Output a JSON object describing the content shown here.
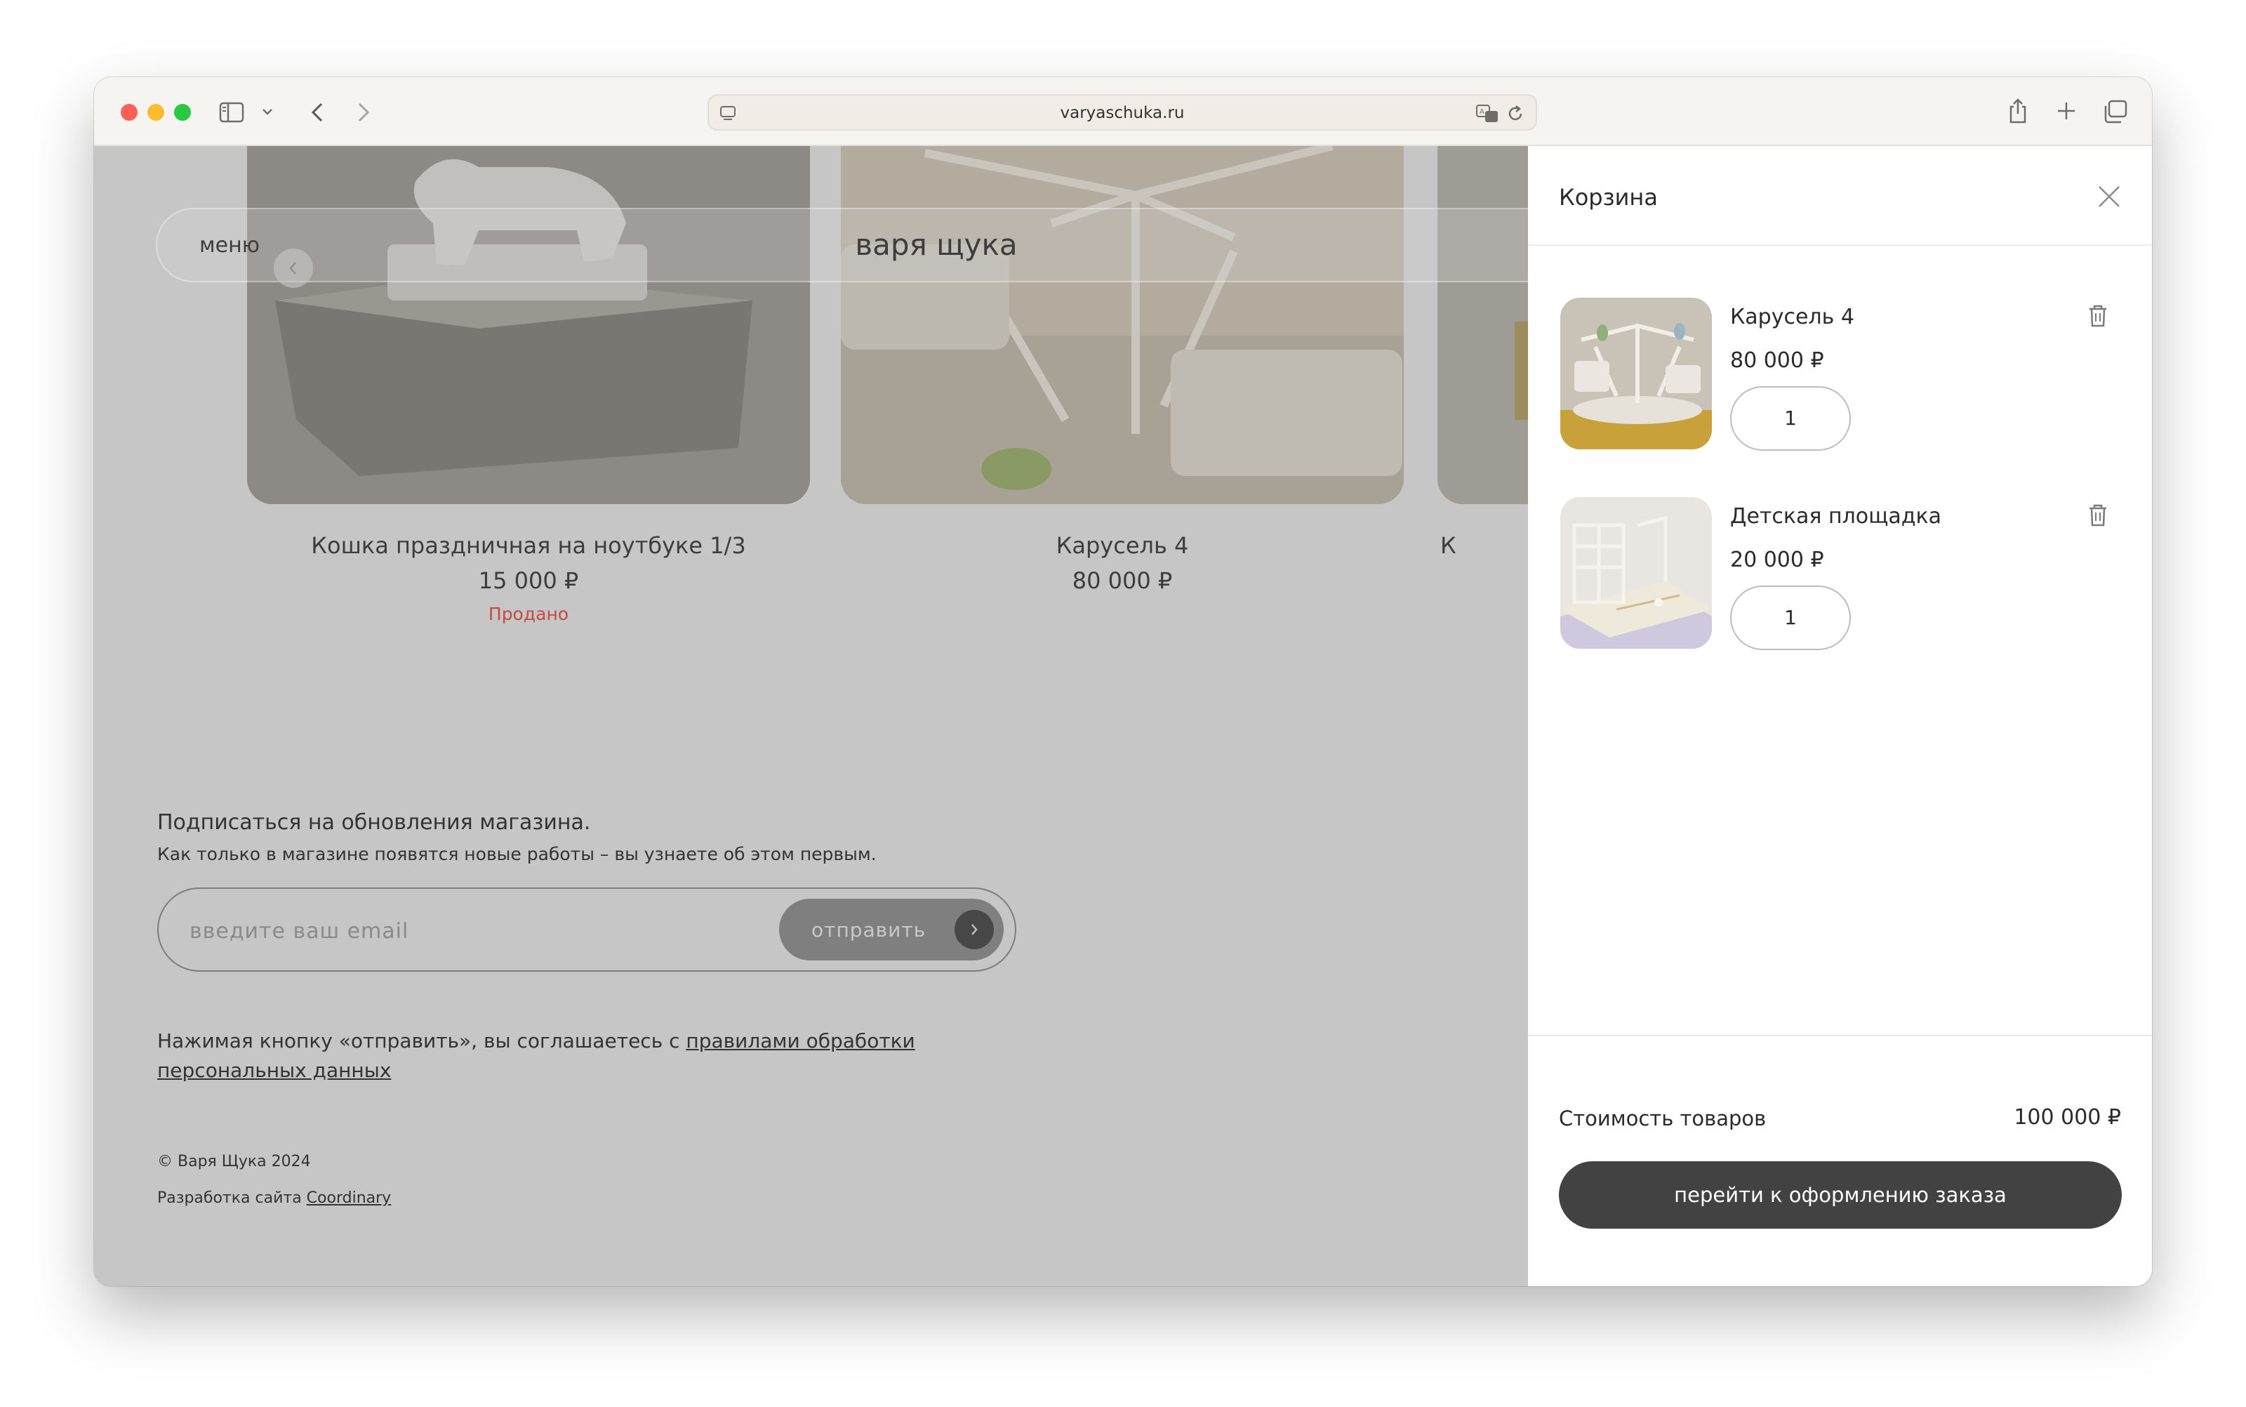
{
  "browser": {
    "url": "varyaschuka.ru",
    "icons": [
      "sidebar-icon",
      "chevron-down-icon",
      "back-icon",
      "forward-icon",
      "translate-icon",
      "reload-icon",
      "share-icon",
      "new-tab-icon",
      "tabs-overview-icon"
    ]
  },
  "header": {
    "menu_label": "меню",
    "brand": "варя щука"
  },
  "products": [
    {
      "title": "Кошка праздничная на ноутбуке 1/3",
      "price": "15 000 ₽",
      "status": "Продано"
    },
    {
      "title": "Карусель 4",
      "price": "80 000 ₽",
      "status": ""
    },
    {
      "title": "К",
      "price": "",
      "status": ""
    }
  ],
  "subscribe": {
    "title": "Подписаться на обновления магазина.",
    "text": "Как только в магазине появятся новые работы – вы узнаете об этом первым.",
    "placeholder": "введите ваш email",
    "button": "отправить",
    "consent_prefix": "Нажимая кнопку «отправить», вы соглашаетесь с ",
    "consent_link": "правилами обработки персональных данных"
  },
  "footer": {
    "copyright": "© Варя Щука 2024",
    "dev_prefix": "Разработка сайта ",
    "dev_link": "Coordinary"
  },
  "cart": {
    "title": "Корзина",
    "items": [
      {
        "name": "Карусель 4",
        "price": "80 000 ₽",
        "quantity": "1"
      },
      {
        "name": "Детская площадка",
        "price": "20 000 ₽",
        "quantity": "1"
      }
    ],
    "total_label": "Стоимость товаров",
    "total_value": "100 000 ₽",
    "checkout": "перейти к оформлению заказа"
  },
  "colors": {
    "overlay": "#c6c6c6",
    "sold": "#c44b44",
    "checkout_button": "#424242"
  }
}
